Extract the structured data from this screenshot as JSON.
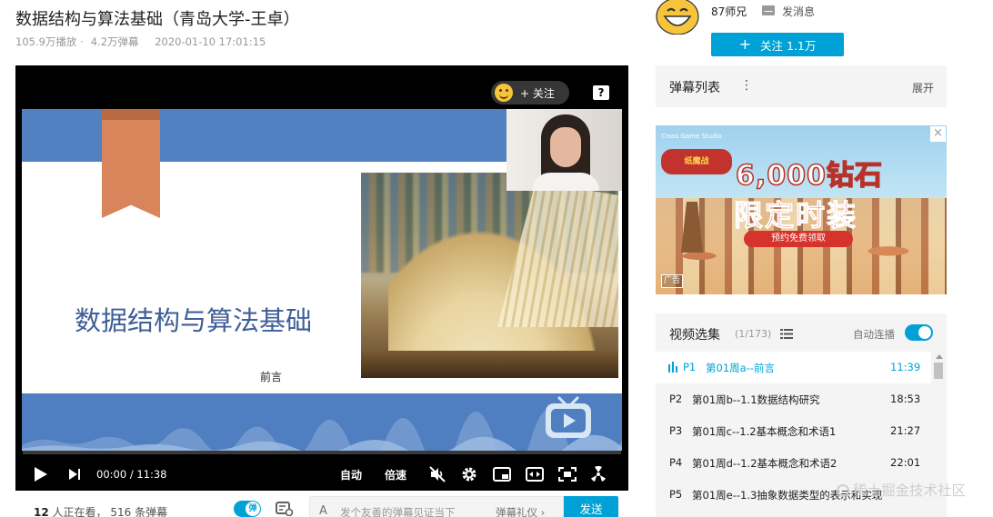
{
  "video": {
    "title": "数据结构与算法基础（青岛大学-王卓）",
    "plays": "105.9万播放",
    "separator": "·",
    "danmaku_count": "4.2万弹幕",
    "date": "2020-01-10 17:01:15"
  },
  "player": {
    "follow_overlay": "+ 关注",
    "help": "?",
    "slide": {
      "title": "数据结构与算法基础",
      "subtitle": "前言"
    },
    "progress": 0.0,
    "time_current": "00:00",
    "time_sep": "/",
    "time_total": "11:38",
    "auto_label": "自动",
    "speed_label": "倍速"
  },
  "bottom_bar": {
    "viewers_count": "12",
    "viewers_text": "人正在看，",
    "danmaku_num": "516",
    "danmaku_text": "条弹幕",
    "toggle_label": "弹",
    "input_icon": "A",
    "input_placeholder": "发个友善的弹幕见证当下",
    "etiquette": "弹幕礼仪 ›",
    "send_label": "发送"
  },
  "uploader": {
    "name": "87师兄",
    "message_label": "发消息",
    "follow_label": "关注 1.1万",
    "follow_plus": "+"
  },
  "danmaku_list": {
    "title": "弹幕列表",
    "menu": "⋮",
    "expand": "展开"
  },
  "ad": {
    "top_text": "Cross Game Studio",
    "logo_text": "纸魔战",
    "headline": "6,000钻石",
    "headline2": "限定时装",
    "ribbon": "预约免费领取",
    "tag": "广告",
    "close": "×"
  },
  "playlist": {
    "title": "视频选集",
    "count": "(1/173)",
    "autoplay_label": "自动连播",
    "episodes": [
      {
        "num": "P1",
        "name": "第01周a--前言",
        "dur": "11:39"
      },
      {
        "num": "P2",
        "name": "第01周b--1.1数据结构研究",
        "dur": "18:53"
      },
      {
        "num": "P3",
        "name": "第01周c--1.2基本概念和术语1",
        "dur": "21:27"
      },
      {
        "num": "P4",
        "name": "第01周d--1.2基本概念和术语2",
        "dur": "22:01"
      },
      {
        "num": "P5",
        "name": "第01周e--1.3抽象数据类型的表示和实现",
        "dur": ""
      }
    ]
  },
  "watermark": "稀土掘金技术社区",
  "colors": {
    "accent": "#00a1d6",
    "slide_blue": "#5181c1",
    "bookmark": "#d9855b"
  }
}
